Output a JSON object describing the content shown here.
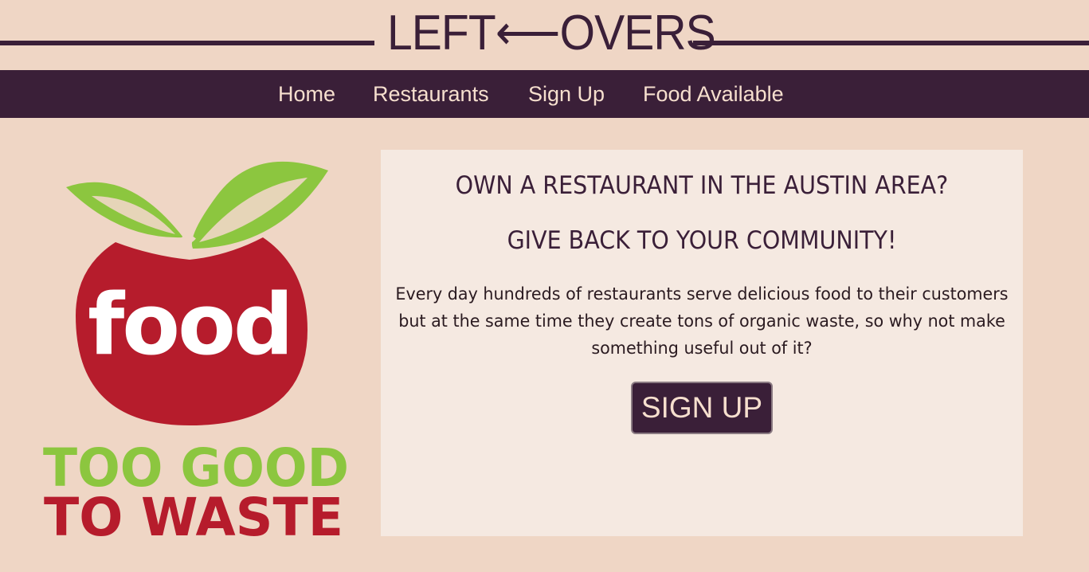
{
  "header": {
    "title": "LEFT⟵OVERS"
  },
  "nav": {
    "items": [
      {
        "label": "Home"
      },
      {
        "label": "Restaurants"
      },
      {
        "label": "Sign Up"
      },
      {
        "label": "Food Available"
      }
    ]
  },
  "logo": {
    "word": "food",
    "line1": "TOO GOOD",
    "line2": "TO WASTE"
  },
  "card": {
    "heading1": "OWN A RESTAURANT IN THE AUSTIN AREA?",
    "heading2": "GIVE BACK TO YOUR COMMUNITY!",
    "body": "Every day hundreds of restaurants serve delicious food to their customers but at the same time they create tons of organic waste, so why not make something useful out of it?",
    "button_label": "SIGN UP"
  },
  "colors": {
    "background": "#efd6c5",
    "brand_dark": "#3a1f38",
    "nav_text": "#f6dfce",
    "card_background": "#f5e9e1",
    "logo_red": "#b61c2c",
    "logo_green": "#8cc63f"
  }
}
